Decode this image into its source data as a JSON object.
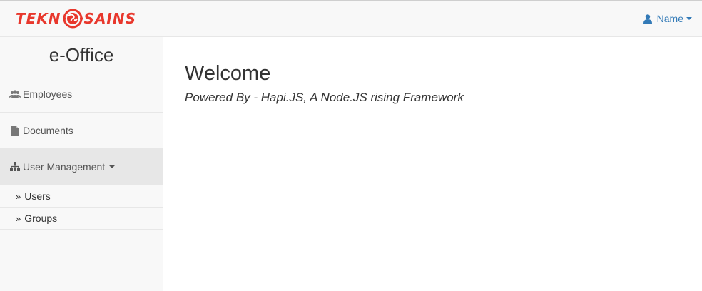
{
  "brand": {
    "left_text": "TEKN",
    "right_text": "SAINS",
    "color": "#e8372c"
  },
  "header": {
    "user_label": "Name",
    "user_icon": "user-icon",
    "accent": "#337ab7"
  },
  "sidebar": {
    "title": "e-Office",
    "items": [
      {
        "label": "Employees",
        "icon": "users-icon"
      },
      {
        "label": "Documents",
        "icon": "file-icon"
      },
      {
        "label": "User Management",
        "icon": "sitemap-icon",
        "expanded": true
      }
    ],
    "subitems": [
      {
        "label": "Users",
        "icon": "double-chevron-right-icon"
      },
      {
        "label": "Groups",
        "icon": "double-chevron-right-icon"
      }
    ]
  },
  "main": {
    "title": "Welcome",
    "subtitle": "Powered By - Hapi.JS, A Node.JS rising Framework"
  }
}
